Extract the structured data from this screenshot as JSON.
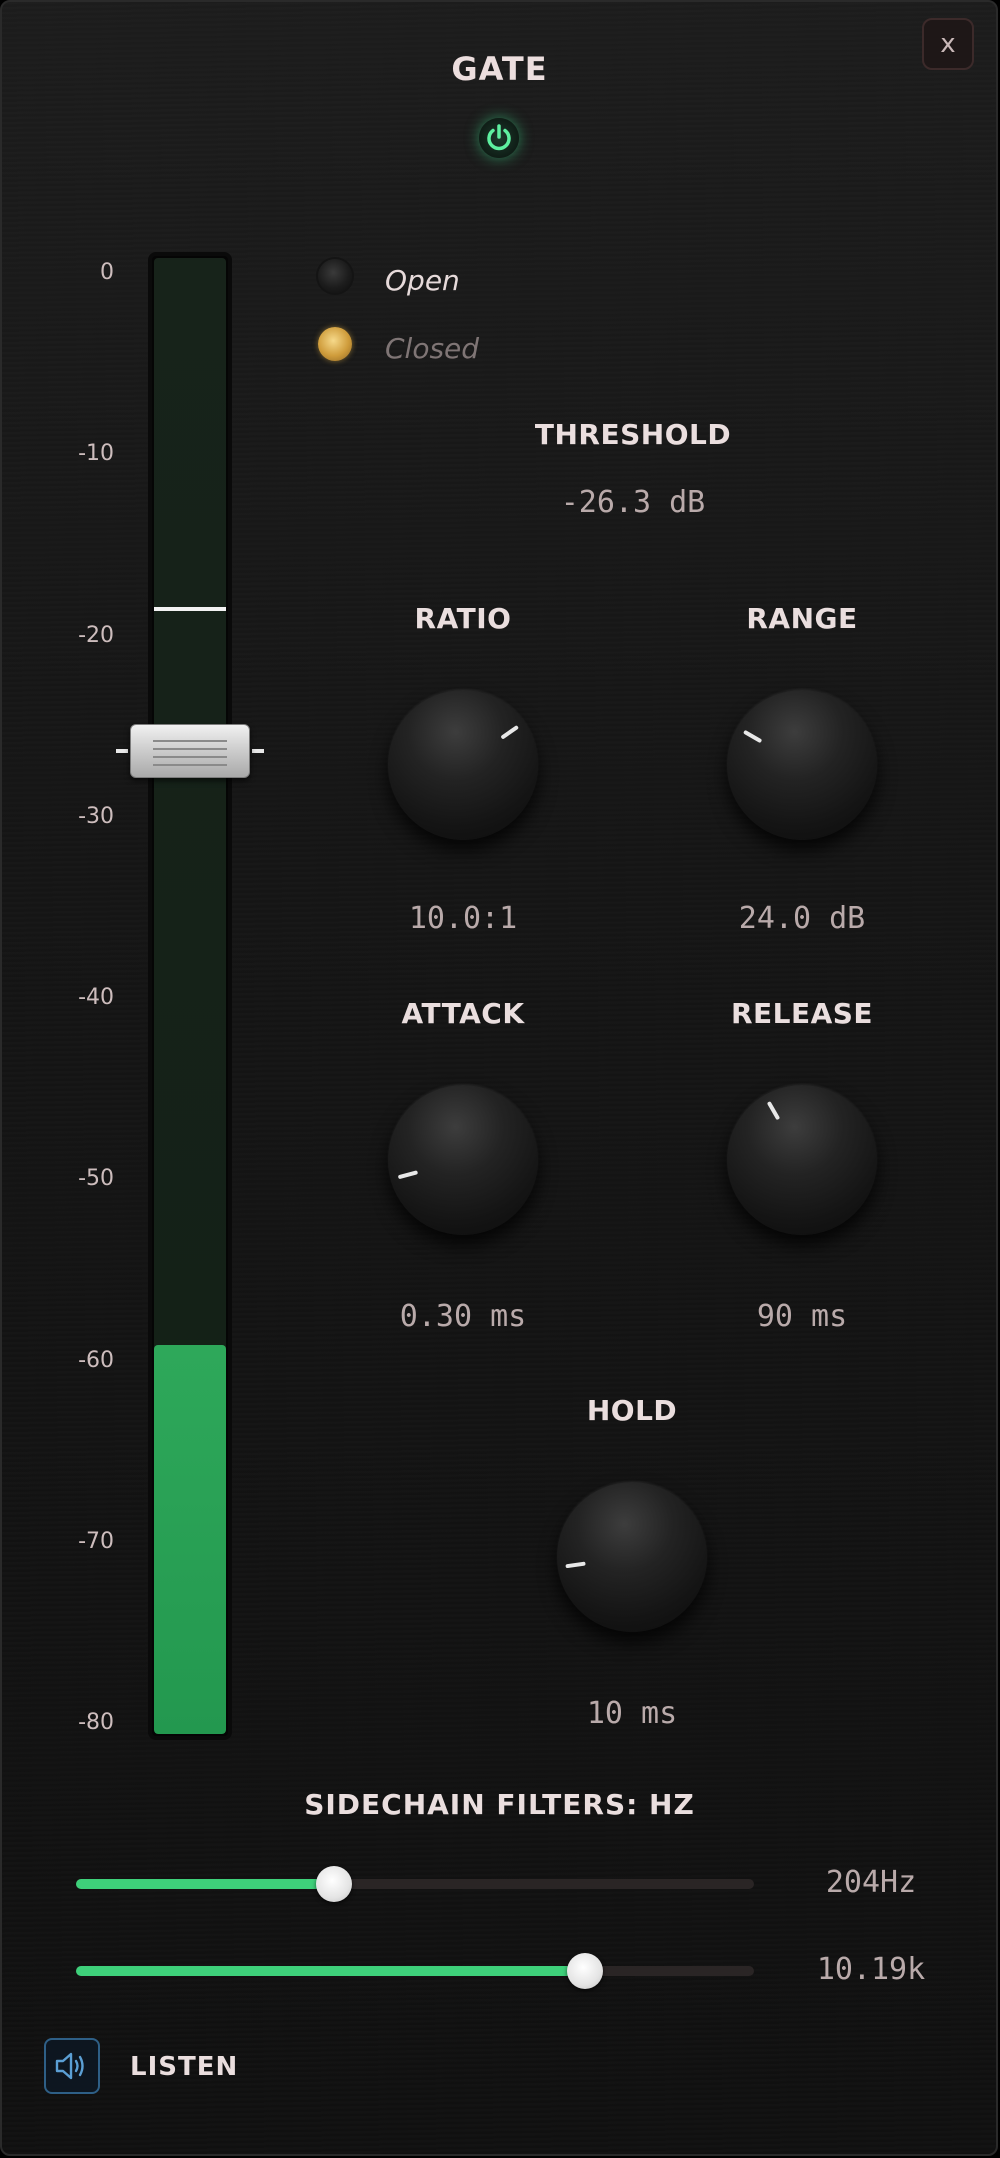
{
  "header": {
    "title": "GATE",
    "close_label": "x",
    "power_icon": "power-icon",
    "accent_color": "#3ed07a"
  },
  "meter": {
    "scale_labels": [
      "0",
      "-10",
      "-20",
      "-30",
      "-40",
      "-50",
      "-60",
      "-70",
      "-80"
    ],
    "level_db": -59,
    "peak_db": -18.5,
    "threshold_db": -26.3
  },
  "status": {
    "open_label": "Open",
    "closed_label": "Closed",
    "active": "closed"
  },
  "threshold": {
    "label": "THRESHOLD",
    "value": "-26.3 dB"
  },
  "knobs": [
    {
      "id": "ratio",
      "label": "RATIO",
      "value": "10.0:1",
      "angle": 55
    },
    {
      "id": "range",
      "label": "RANGE",
      "value": "24.0 dB",
      "angle": -60
    },
    {
      "id": "attack",
      "label": "ATTACK",
      "value": "0.30 ms",
      "angle": -105
    },
    {
      "id": "release",
      "label": "RELEASE",
      "value": "90 ms",
      "angle": -30
    },
    {
      "id": "hold",
      "label": "HOLD",
      "value": "10 ms",
      "angle": -98
    }
  ],
  "sidechain": {
    "label": "SIDECHAIN FILTERS: HZ",
    "sliders": [
      {
        "id": "low",
        "value": "204Hz",
        "position": 0.38
      },
      {
        "id": "high",
        "value": "10.19k",
        "position": 0.75
      }
    ]
  },
  "listen": {
    "label": "LISTEN",
    "icon": "speaker-icon"
  }
}
